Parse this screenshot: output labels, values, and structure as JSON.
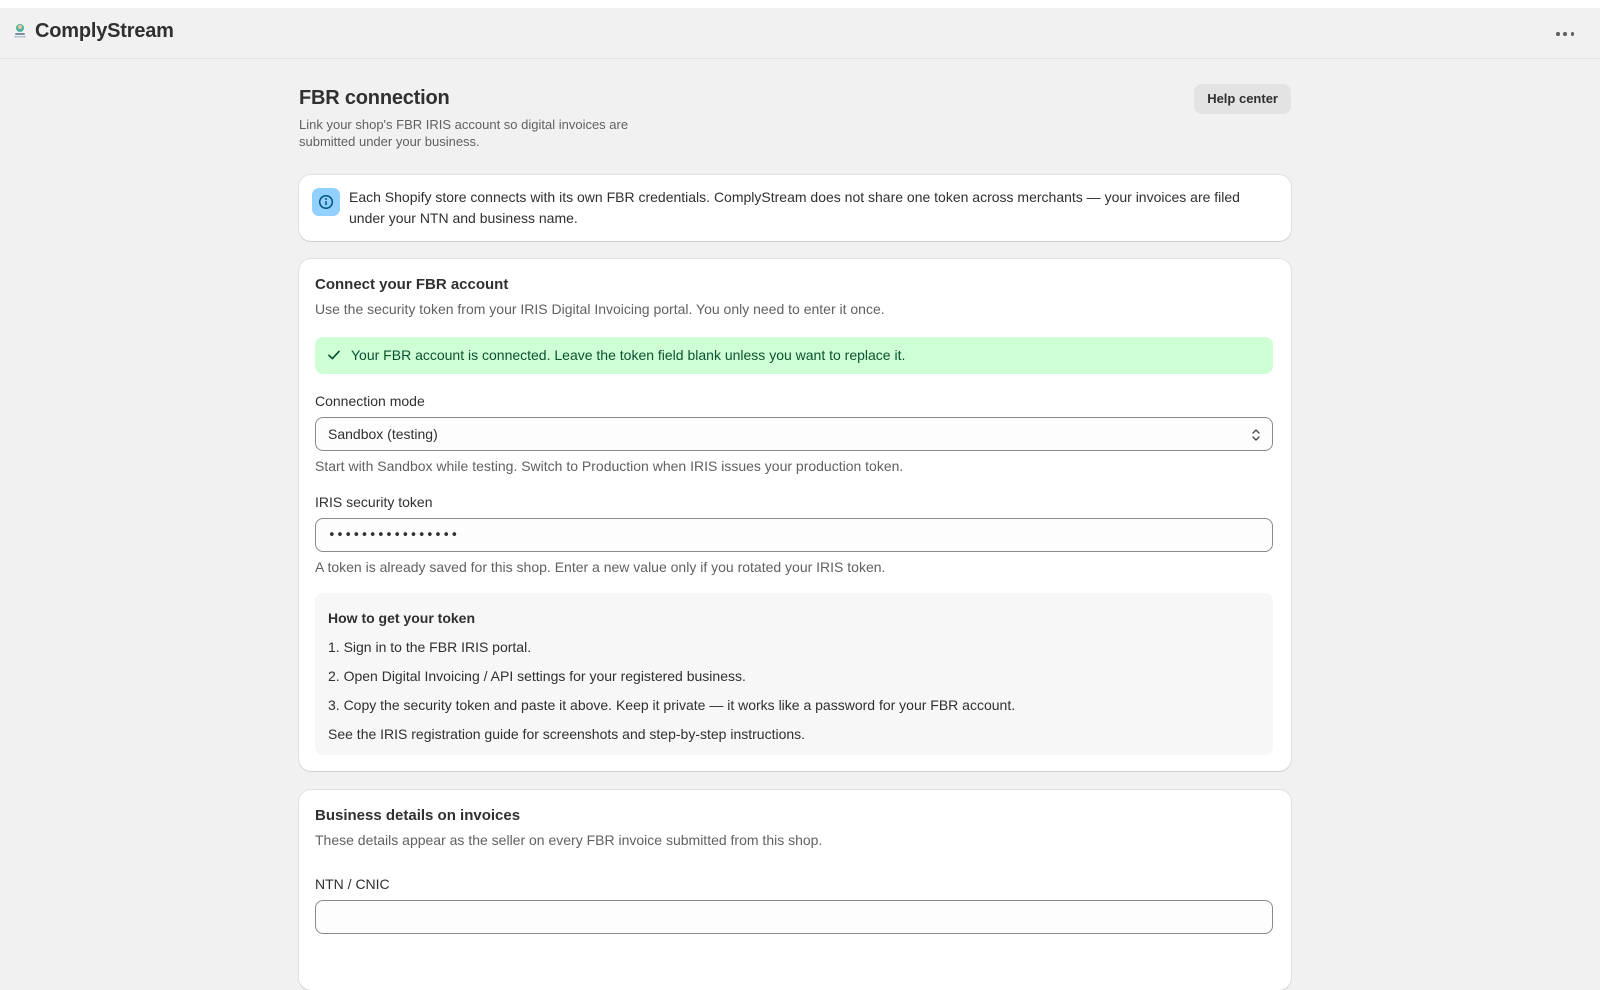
{
  "app": {
    "title": "ComplyStream",
    "more_icon": "more-horizontal-icon",
    "logo_icon": "app-logo-icon"
  },
  "header": {
    "title": "FBR connection",
    "subtitle": "Link your shop's FBR IRIS account so digital invoices are submitted under your business.",
    "help_button": "Help center"
  },
  "info_banner": {
    "icon": "info-icon",
    "text": "Each Shopify store connects with its own FBR credentials. ComplyStream does not share one token across merchants — your invoices are filed under your NTN and business name."
  },
  "connect_card": {
    "title": "Connect your FBR account",
    "description": "Use the security token from your IRIS Digital Invoicing portal. You only need to enter it once.",
    "success_banner": "Your FBR account is connected. Leave the token field blank unless you want to replace it.",
    "mode": {
      "label": "Connection mode",
      "value": "Sandbox (testing)",
      "help": "Start with Sandbox while testing. Switch to Production when IRIS issues your production token."
    },
    "token": {
      "label": "IRIS security token",
      "value": "••••••••••••••••",
      "help": "A token is already saved for this shop. Enter a new value only if you rotated your IRIS token."
    },
    "howto": {
      "title": "How to get your token",
      "steps": [
        "1. Sign in to the FBR IRIS portal.",
        "2. Open Digital Invoicing / API settings for your registered business.",
        "3. Copy the security token and paste it above. Keep it private — it works like a password for your FBR account."
      ],
      "footer": "See the IRIS registration guide for screenshots and step-by-step instructions."
    }
  },
  "business_card": {
    "title": "Business details on invoices",
    "description": "These details appear as the seller on every FBR invoice submitted from this shop.",
    "ntn_label": "NTN / CNIC"
  },
  "colors": {
    "background": "#f1f1f1",
    "card": "#ffffff",
    "info_icon_bg": "#91d0ff",
    "success_bg": "#cdfed4",
    "success_text": "#0c5132"
  }
}
